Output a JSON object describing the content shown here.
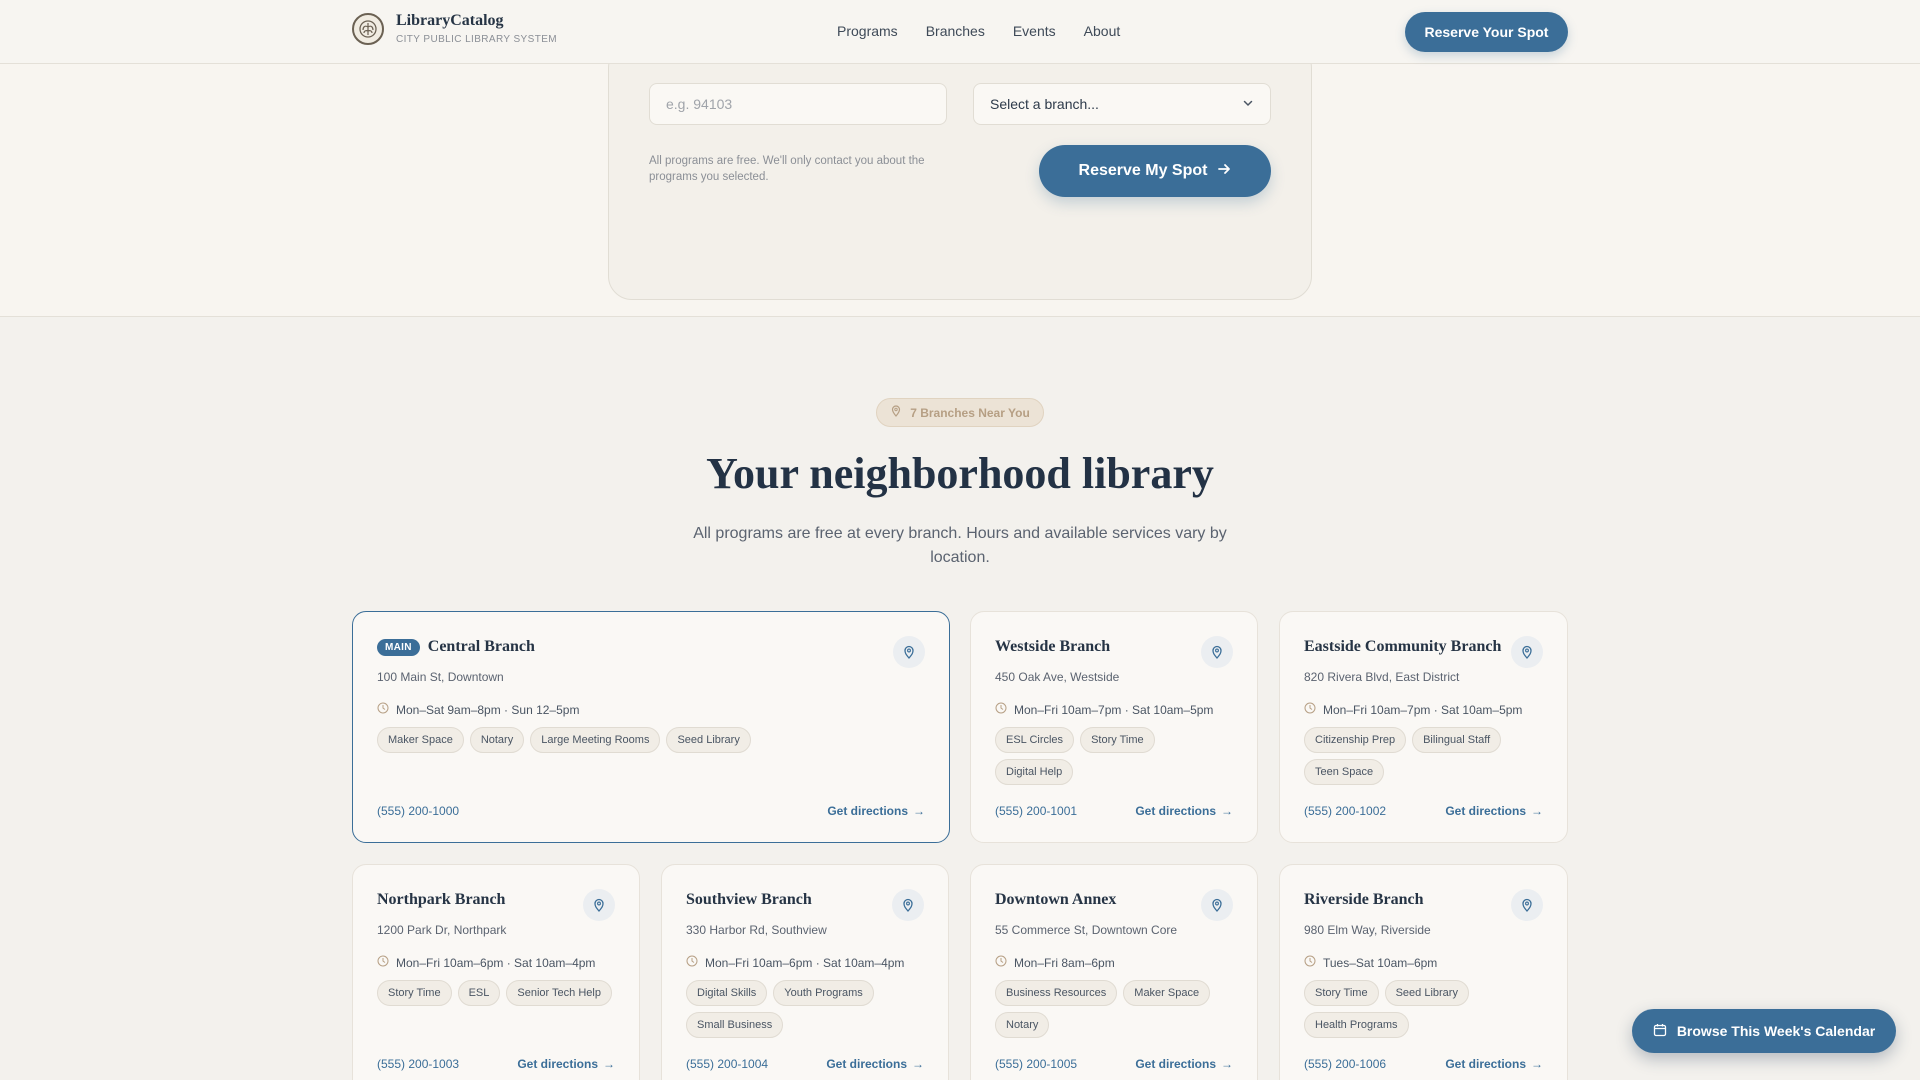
{
  "header": {
    "brand_name": "LibraryCatalog",
    "brand_sub": "CITY PUBLIC LIBRARY SYSTEM",
    "logo_icon": "book-tree-icon",
    "nav": [
      "Programs",
      "Branches",
      "Events",
      "About"
    ],
    "reserve_label": "Reserve Your Spot"
  },
  "form": {
    "zip_placeholder": "e.g. 94103",
    "branch_select": "Select a branch...",
    "note": "All programs are free. We'll only contact you about the programs you selected.",
    "submit_label": "Reserve My Spot"
  },
  "branches_section": {
    "pill_label": "7 Branches Near You",
    "title": "Your neighborhood library",
    "subtitle": "All programs are free at every branch. Hours and available services vary by location.",
    "directions_label": "Get directions",
    "main_badge": "MAIN",
    "cards": [
      {
        "name": "Central Branch",
        "address": "100 Main St, Downtown",
        "hours": "Mon–Sat 9am–8pm · Sun 12–5pm",
        "tags": [
          "Maker Space",
          "Notary",
          "Large Meeting Rooms",
          "Seed Library"
        ],
        "phone": "(555) 200-1000"
      },
      {
        "name": "Westside Branch",
        "address": "450 Oak Ave, Westside",
        "hours": "Mon–Fri 10am–7pm · Sat 10am–5pm",
        "tags": [
          "ESL Circles",
          "Story Time",
          "Digital Help"
        ],
        "phone": "(555) 200-1001"
      },
      {
        "name": "Eastside Community Branch",
        "address": "820 Rivera Blvd, East District",
        "hours": "Mon–Fri 10am–7pm · Sat 10am–5pm",
        "tags": [
          "Citizenship Prep",
          "Bilingual Staff",
          "Teen Space"
        ],
        "phone": "(555) 200-1002"
      },
      {
        "name": "Northpark Branch",
        "address": "1200 Park Dr, Northpark",
        "hours": "Mon–Fri 10am–6pm · Sat 10am–4pm",
        "tags": [
          "Story Time",
          "ESL",
          "Senior Tech Help"
        ],
        "phone": "(555) 200-1003"
      },
      {
        "name": "Southview Branch",
        "address": "330 Harbor Rd, Southview",
        "hours": "Mon–Fri 10am–6pm · Sat 10am–4pm",
        "tags": [
          "Digital Skills",
          "Youth Programs",
          "Small Business"
        ],
        "phone": "(555) 200-1004"
      },
      {
        "name": "Downtown Annex",
        "address": "55 Commerce St, Downtown Core",
        "hours": "Mon–Fri 8am–6pm",
        "tags": [
          "Business Resources",
          "Maker Space",
          "Notary"
        ],
        "phone": "(555) 200-1005"
      },
      {
        "name": "Riverside Branch",
        "address": "980 Elm Way, Riverside",
        "hours": "Tues–Sat 10am–6pm",
        "tags": [
          "Story Time",
          "Seed Library",
          "Health Programs"
        ],
        "phone": "(555) 200-1006"
      }
    ]
  },
  "fab": {
    "label": "Browse This Week's Calendar",
    "icon": "calendar-icon"
  },
  "colors": {
    "accent": "#3b6e98",
    "background": "#f3f1ed",
    "heading": "#233245"
  }
}
